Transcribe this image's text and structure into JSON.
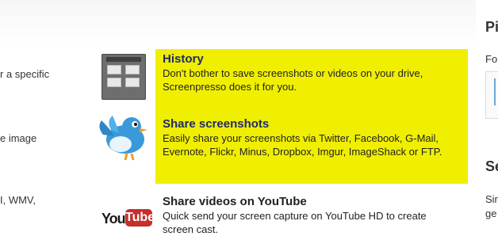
{
  "left_snippets": [
    "r a specific",
    "e image",
    "I, WMV,"
  ],
  "features": [
    {
      "title": "History",
      "description": "Don't bother to save screenshots or videos on your drive, Screenpresso does it for you.",
      "icon": "history-icon"
    },
    {
      "title": "Share screenshots",
      "description": "Easily share your screenshots via Twitter, Facebook, G-Mail, Evernote, Flickr, Minus, Dropbox, Imgur, ImageShack or FTP.",
      "icon": "twitter-bird-icon"
    },
    {
      "title": "Share videos on YouTube",
      "description": "Quick send your screen capture on YouTube HD to create screen cast.",
      "icon": "youtube-logo"
    }
  ],
  "youtube_logo": {
    "you": "You",
    "tube": "Tube"
  },
  "right_snippets": {
    "heading1": "Pi",
    "text1": "Fo",
    "heading2": "Se",
    "text2a": "Sir",
    "text2b": "ge"
  },
  "colors": {
    "highlight": "#f0ef00",
    "title_blue": "#1f2a6b",
    "youtube_red": "#c4302b",
    "twitter_blue": "#3a9ad9"
  }
}
